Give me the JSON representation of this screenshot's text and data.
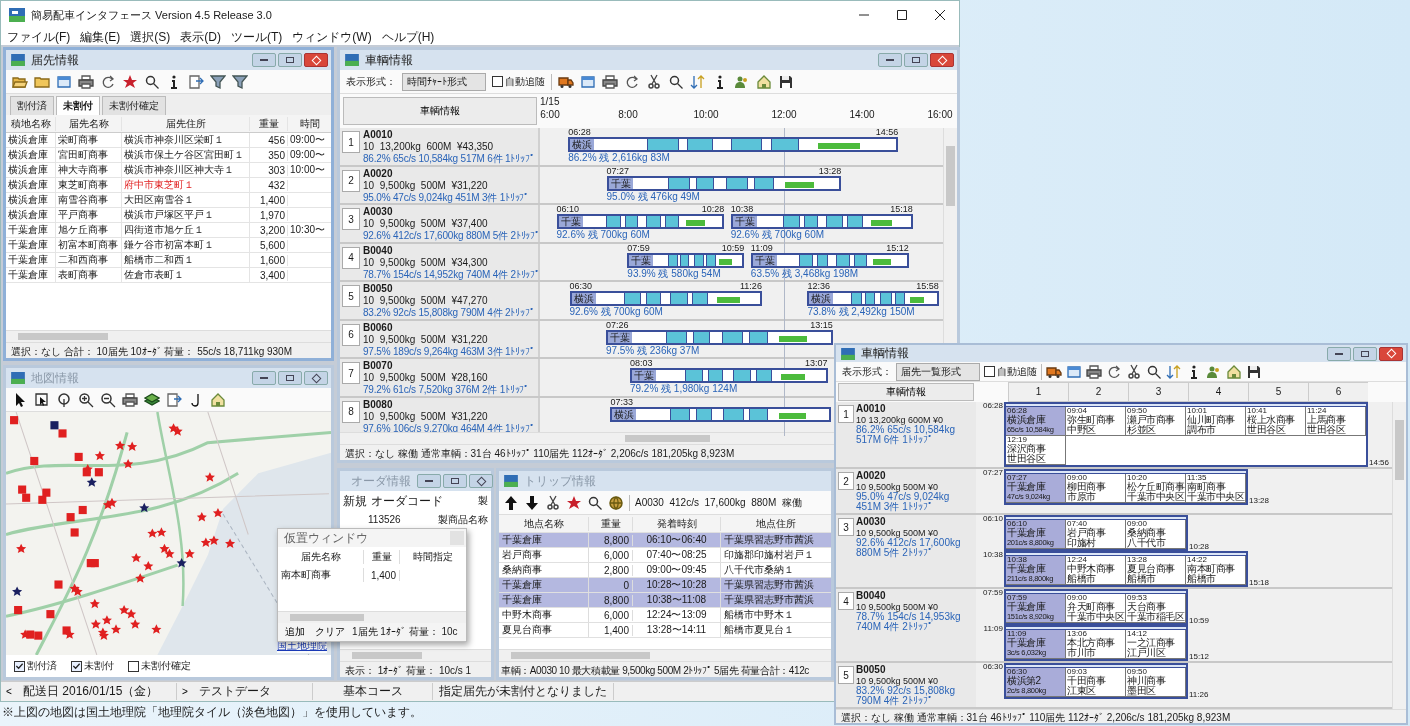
{
  "app": {
    "title": "簡易配車インタフェース Version 4.5 Release 3.0",
    "menu": [
      "ファイル(F)",
      "編集(E)",
      "選択(S)",
      "表示(D)",
      "ツール(T)",
      "ウィンドウ(W)",
      "ヘルプ(H)"
    ]
  },
  "destinations": {
    "title": "届先情報",
    "tabs": [
      {
        "label": "割付済",
        "selected": false
      },
      {
        "label": "未割付",
        "selected": true
      },
      {
        "label": "未割付確定",
        "selected": false
      }
    ],
    "columns": [
      "積地名称",
      "届先名称",
      "届先住所",
      "重量",
      "時間"
    ],
    "rows": [
      {
        "depot": "横浜倉庫",
        "name": "栄町商事",
        "address": "横浜市神奈川区栄町１",
        "weight": "456",
        "time": "09:00〜",
        "alert": false
      },
      {
        "depot": "横浜倉庫",
        "name": "宮田町商事",
        "address": "横浜市保土ケ谷区宮田町１",
        "weight": "350",
        "time": "09:00〜",
        "alert": false
      },
      {
        "depot": "横浜倉庫",
        "name": "神大寺商事",
        "address": "横浜市神奈川区神大寺１",
        "weight": "303",
        "time": "10:00〜",
        "alert": false
      },
      {
        "depot": "横浜倉庫",
        "name": "東芝町商事",
        "address": "府中市東芝町１",
        "weight": "432",
        "alert": true
      },
      {
        "depot": "横浜倉庫",
        "name": "南雪谷商事",
        "address": "大田区南雪谷１",
        "weight": "1,400",
        "alert": false
      },
      {
        "depot": "横浜倉庫",
        "name": "平戸商事",
        "address": "横浜市戸塚区平戸１",
        "weight": "1,970",
        "alert": false
      },
      {
        "depot": "千葉倉庫",
        "name": "旭ケ丘商事",
        "address": "四街道市旭ケ丘１",
        "weight": "3,200",
        "time": "10:30〜",
        "alert": false
      },
      {
        "depot": "千葉倉庫",
        "name": "初富本町商事",
        "address": "鎌ケ谷市初富本町１",
        "weight": "5,600",
        "alert": false
      },
      {
        "depot": "千葉倉庫",
        "name": "二和西商事",
        "address": "船橋市二和西１",
        "weight": "1,600",
        "alert": false
      },
      {
        "depot": "千葉倉庫",
        "name": "表町商事",
        "address": "佐倉市表町１",
        "weight": "3,400",
        "alert": false
      }
    ],
    "status": "選択：なし 合計： 10届先 10ｵｰﾀﾞ 荷量： 55c/s 18,711kg 930M"
  },
  "vehicles": {
    "title": "車輌情報",
    "display_label": "表示形式：",
    "display_mode": "時間ﾁｬｰﾄ形式",
    "auto_follow": {
      "label": "自動追随",
      "checked": false
    },
    "header_button": "車輌情報",
    "date": "1/15",
    "ticks": [
      "6:00",
      "8:00",
      "10:00",
      "12:00",
      "14:00",
      "16:00"
    ],
    "rows": [
      {
        "number": "1",
        "code": "A0010",
        "spec": "10  13,200kg  600M  ¥43,350",
        "stats": "86.2% 65c/s 10,584kg 517M 6件 1ﾄﾘｯﾌﾟ",
        "trips": [
          {
            "start": "06:28",
            "end": "14:56",
            "depot": "横浜",
            "summary": "86.2% 残 2,616kg 83M"
          }
        ]
      },
      {
        "number": "2",
        "code": "A0020",
        "spec": "10  9,500kg  500M  ¥31,220",
        "stats": "95.0% 47c/s 9,024kg 451M 3件 1ﾄﾘｯﾌﾟ",
        "trips": [
          {
            "start": "07:27",
            "end": "13:28",
            "depot": "千葉",
            "summary": "95.0% 残 476kg 49M"
          }
        ]
      },
      {
        "number": "3",
        "code": "A0030",
        "spec": "10  9,500kg  500M  ¥37,400",
        "stats": "92.6% 412c/s 17,600kg 880M 5件 2ﾄﾘｯﾌﾟ",
        "trips": [
          {
            "start": "06:10",
            "end": "10:28",
            "depot": "千葉",
            "summary": "92.6% 残 700kg 60M"
          },
          {
            "start": "10:38",
            "end": "15:18",
            "depot": "千葉",
            "summary": "92.6% 残 700kg 60M"
          }
        ]
      },
      {
        "number": "4",
        "code": "B0040",
        "spec": "10  9,500kg  500M  ¥34,300",
        "stats": "78.7% 154c/s 14,952kg 740M 4件 2ﾄﾘｯﾌﾟ",
        "trips": [
          {
            "start": "07:59",
            "end": "10:59",
            "depot": "千葉",
            "summary": "93.9% 残 580kg 54M"
          },
          {
            "start": "11:09",
            "end": "15:12",
            "depot": "千葉",
            "summary": "63.5% 残 3,468kg 198M"
          }
        ]
      },
      {
        "number": "5",
        "code": "B0050",
        "spec": "10  9,500kg  500M  ¥47,270",
        "stats": "83.2% 92c/s 15,808kg 790M 4件 2ﾄﾘｯﾌﾟ",
        "trips": [
          {
            "start": "06:30",
            "end": "11:26",
            "depot": "横浜",
            "summary": "92.6% 残 700kg 60M"
          },
          {
            "start": "12:36",
            "end": "15:58",
            "depot": "横浜",
            "summary": "73.8% 残 2,492kg 150M"
          }
        ]
      },
      {
        "number": "6",
        "code": "B0060",
        "spec": "10  9,500kg  500M  ¥31,220",
        "stats": "97.5% 189c/s 9,264kg 463M 3件 1ﾄﾘｯﾌﾟ",
        "trips": [
          {
            "start": "07:26",
            "end": "13:15",
            "depot": "千葉",
            "summary": "97.5% 残 236kg 37M"
          }
        ]
      },
      {
        "number": "7",
        "code": "B0070",
        "spec": "10  9,500kg  500M  ¥28,160",
        "stats": "79.2% 61c/s 7,520kg 376M 2件 1ﾄﾘｯﾌﾟ",
        "trips": [
          {
            "start": "08:03",
            "end": "13:07",
            "depot": "千葉",
            "summary": "79.2% 残 1,980kg 124M"
          }
        ]
      },
      {
        "number": "8",
        "code": "B0080",
        "spec": "10  9,500kg  500M  ¥31,220",
        "stats": "97.6% 106c/s 9,270kg 464M 4件 1ﾄﾘｯﾌﾟ",
        "trips": [
          {
            "start": "07:33",
            "depot": "横浜"
          }
        ]
      }
    ],
    "status": "選択：なし 稼働 通常車輌：31台 46ﾄﾘｯﾌﾟ 110届先 112ｵｰﾀﾞ 2,206c/s 181,205kg 8,923M"
  },
  "map": {
    "title": "地図情報",
    "attribution": "国土地理院",
    "checkboxes": [
      {
        "label": "割付済",
        "checked": true
      },
      {
        "label": "未割付",
        "checked": true
      },
      {
        "label": "未割付確定",
        "checked": false
      }
    ]
  },
  "orders": {
    "title": "オーダ情報",
    "columns": [
      "新規",
      "オーダコード",
      "製"
    ],
    "row": {
      "code": "113526",
      "product": "製商品名称"
    },
    "status": "表示： 1ｵｰﾀﾞ 荷量： 10c/s 1"
  },
  "staging": {
    "title": "仮置ウィンドウ",
    "columns": [
      "届先名称",
      "重量",
      "時間指定"
    ],
    "row": {
      "name": "南本町商事",
      "weight": "1,400"
    },
    "buttons": [
      "追加",
      "クリア"
    ],
    "summary": "1届先 1ｵｰﾀﾞ 荷量： 10c"
  },
  "trip": {
    "title": "トリップ情報",
    "info": "A0030  412c/s  17,600kg  880M  稼働",
    "columns": [
      "地点名称",
      "重量",
      "発着時刻",
      "地点住所"
    ],
    "rows": [
      {
        "kind": "depot",
        "name": "千葉倉庫",
        "weight": "8,800",
        "time": "06:10〜06:40",
        "address": "千葉県習志野市茜浜"
      },
      {
        "kind": "stop",
        "name": "岩戸商事",
        "weight": "6,000",
        "time": "07:40〜08:25",
        "address": "印旛郡印旛村岩戸１"
      },
      {
        "kind": "stop",
        "name": "桑納商事",
        "weight": "2,800",
        "time": "09:00〜09:45",
        "address": "八千代市桑納１"
      },
      {
        "kind": "depot",
        "name": "千葉倉庫",
        "weight": "0",
        "time": "10:28〜10:28",
        "address": "千葉県習志野市茜浜"
      },
      {
        "kind": "depot",
        "name": "千葉倉庫",
        "weight": "8,800",
        "time": "10:38〜11:08",
        "address": "千葉県習志野市茜浜"
      },
      {
        "kind": "stop",
        "name": "中野木商事",
        "weight": "6,000",
        "time": "12:24〜13:09",
        "address": "船橋市中野木１"
      },
      {
        "kind": "stop",
        "name": "夏見台商事",
        "weight": "1,400",
        "time": "13:28〜14:11",
        "address": "船橋市夏見台１"
      }
    ],
    "status": "車輌：A0030 10 最大積載量 9,500kg 500M 2ﾄﾘｯﾌﾟ 5届先 荷量合計：412c"
  },
  "status_bar": {
    "prev": "<",
    "date": "配送日 2016/01/15（金）",
    "next": ">",
    "dataset": "テストデータ",
    "course": "基本コース",
    "message": "指定届先が未割付となりました"
  },
  "caption": "※上図の地図は国土地理院「地理院タイル（淡色地図）」を使用しています。",
  "list_window": {
    "title": "車輌情報",
    "display_label": "表示形式：",
    "display_mode": "届先一覧形式",
    "auto_follow": {
      "label": "自動追随",
      "checked": false
    },
    "header_button": "車輌情報",
    "columns": [
      "1",
      "2",
      "3",
      "4",
      "5",
      "6"
    ],
    "vehicles": [
      {
        "number": "1",
        "code": "A0010",
        "spec": "10 13,200kg 600M ¥0",
        "stats": "86.2% 65c/s 10,584kg 517M 6件 1ﾄﾘｯﾌﾟ",
        "trips": [
          {
            "start": "06:28",
            "end": "14:56",
            "stops": [
              {
                "kind": "depot",
                "time": "06:28",
                "name": "横浜倉庫",
                "detail": "65c/s 10,584kg"
              },
              {
                "kind": "stop",
                "time": "09:04",
                "name": "弥生町商事",
                "detail": "中野区"
              },
              {
                "kind": "stop",
                "time": "09:50",
                "name": "瀬戸市商事",
                "detail": "杉並区"
              },
              {
                "kind": "stop",
                "time": "10:01",
                "name": "仙川町商事",
                "detail": "調布市"
              },
              {
                "kind": "stop",
                "time": "10:41",
                "name": "桜上水商事",
                "detail": "世田谷区"
              },
              {
                "kind": "stop",
                "time": "11:24",
                "name": "上馬商事",
                "detail": "世田谷区"
              },
              {
                "kind": "stop",
                "time": "12:19",
                "name": "深沢商事",
                "detail": "世田谷区"
              }
            ]
          }
        ]
      },
      {
        "number": "2",
        "code": "A0020",
        "spec": "10 9,500kg 500M ¥0",
        "stats": "95.0% 47c/s 9,024kg 451M 3件 1ﾄﾘｯﾌﾟ",
        "trips": [
          {
            "start": "07:27",
            "end": "13:28",
            "stops": [
              {
                "kind": "depot",
                "time": "07:27",
                "name": "千葉倉庫",
                "detail": "47c/s 9,024kg"
              },
              {
                "kind": "stop",
                "time": "09:00",
                "name": "柳田商事",
                "detail": "市原市"
              },
              {
                "kind": "stop",
                "time": "10:20",
                "name": "松ケ丘町商事",
                "detail": "千葉市中央区"
              },
              {
                "kind": "stop",
                "time": "11:35",
                "name": "南町商事",
                "detail": "千葉市中央区"
              }
            ]
          }
        ]
      },
      {
        "number": "3",
        "code": "A0030",
        "spec": "10 9,500kg 500M ¥0",
        "stats": "92.6% 412c/s 17,600kg 880M 5件 2ﾄﾘｯﾌﾟ",
        "trips": [
          {
            "start": "06:10",
            "end": "10:28",
            "stops": [
              {
                "kind": "depot",
                "time": "06:10",
                "name": "千葉倉庫",
                "detail": "201c/s 8,800kg"
              },
              {
                "kind": "stop",
                "time": "07:40",
                "name": "岩戸商事",
                "detail": "印旛村"
              },
              {
                "kind": "stop",
                "time": "09:00",
                "name": "桑納商事",
                "detail": "八千代市"
              }
            ]
          },
          {
            "start": "10:38",
            "end": "15:18",
            "stops": [
              {
                "kind": "depot",
                "time": "10:38",
                "name": "千葉倉庫",
                "detail": "211c/s 8,800kg"
              },
              {
                "kind": "stop",
                "time": "12:24",
                "name": "中野木商事",
                "detail": "船橋市"
              },
              {
                "kind": "stop",
                "time": "13:28",
                "name": "夏見台商事",
                "detail": "船橋市"
              },
              {
                "kind": "stop",
                "time": "14:22",
                "name": "南本町商事",
                "detail": "船橋市"
              }
            ]
          }
        ]
      },
      {
        "number": "4",
        "code": "B0040",
        "spec": "10 9,500kg 500M ¥0",
        "stats": "78.7% 154c/s 14,953kg 740M 4件 2ﾄﾘｯﾌﾟ",
        "trips": [
          {
            "start": "07:59",
            "end": "10:59",
            "stops": [
              {
                "kind": "depot",
                "time": "07:59",
                "name": "千葉倉庫",
                "detail": "151c/s 8,920kg"
              },
              {
                "kind": "stop",
                "time": "09:00",
                "name": "弁天町商事",
                "detail": "千葉市中央区"
              },
              {
                "kind": "stop",
                "time": "09:53",
                "name": "天台商事",
                "detail": "千葉市稲毛区"
              }
            ]
          },
          {
            "start": "11:09",
            "end": "15:12",
            "stops": [
              {
                "kind": "depot",
                "time": "11:09",
                "name": "千葉倉庫",
                "detail": "3c/s 6,032kg"
              },
              {
                "kind": "stop",
                "time": "13:06",
                "name": "本北方商事",
                "detail": "市川市"
              },
              {
                "kind": "stop",
                "time": "14:12",
                "name": "一之江商事",
                "detail": "江戸川区"
              }
            ]
          }
        ]
      },
      {
        "number": "5",
        "code": "B0050",
        "spec": "10 9,500kg 500M ¥0",
        "stats": "83.2% 92c/s 15,808kg 790M 4件 2ﾄﾘｯﾌﾟ",
        "trips": [
          {
            "start": "06:30",
            "end": "11:26",
            "stops": [
              {
                "kind": "depot",
                "time": "06:30",
                "name": "横浜第2",
                "detail": "2c/s 8,800kg"
              },
              {
                "kind": "stop",
                "time": "09:03",
                "name": "千田商事",
                "detail": "江東区"
              },
              {
                "kind": "stop",
                "time": "09:50",
                "name": "神川商事",
                "detail": "墨田区"
              }
            ]
          }
        ]
      }
    ],
    "status": "選択：なし 稼働 通常車輌：31台 46ﾄﾘｯﾌﾟ 110届先 112ｵｰﾀﾞ 2,206c/s 181,205kg 8,923M"
  }
}
